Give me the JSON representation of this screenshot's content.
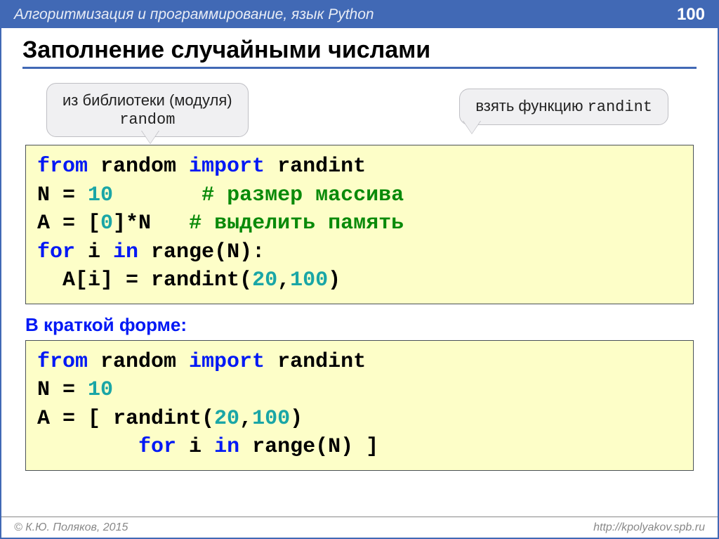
{
  "header": {
    "topic": "Алгоритмизация и программирование, язык Python",
    "page": "100"
  },
  "title": "Заполнение случайными числами",
  "callouts": {
    "left_line1": "из библиотеки (модуля)",
    "left_line2": "random",
    "right_prefix": "взять функцию ",
    "right_mono": "randint"
  },
  "code1": {
    "l1_kw1": "from",
    "l1_txt1": " random ",
    "l1_kw2": "import",
    "l1_txt2": " randint",
    "l2_txt1": "N = ",
    "l2_num": "10",
    "l2_pad": "       ",
    "l2_cmt": "# размер массива",
    "l3_txt1": "A = [",
    "l3_num": "0",
    "l3_txt2": "]*N   ",
    "l3_cmt": "# выделить память",
    "l4_kw1": "for",
    "l4_txt1": " i ",
    "l4_kw2": "in",
    "l4_txt2": " range(N):",
    "l5_txt1": "  A[i] = randint(",
    "l5_n1": "20",
    "l5_c": ",",
    "l5_n2": "100",
    "l5_txt2": ")"
  },
  "subhead": "В краткой форме:",
  "code2": {
    "l1_kw1": "from",
    "l1_txt1": " random ",
    "l1_kw2": "import",
    "l1_txt2": " randint",
    "l2_txt1": "N = ",
    "l2_num": "10",
    "l3_txt1": "A = [ randint(",
    "l3_n1": "20",
    "l3_c": ",",
    "l3_n2": "100",
    "l3_txt2": ") ",
    "l4_pad": "        ",
    "l4_kw1": "for",
    "l4_txt1": " i ",
    "l4_kw2": "in",
    "l4_txt2": " range(N) ]"
  },
  "footer": {
    "left": "© К.Ю. Поляков, 2015",
    "right": "http://kpolyakov.spb.ru"
  }
}
